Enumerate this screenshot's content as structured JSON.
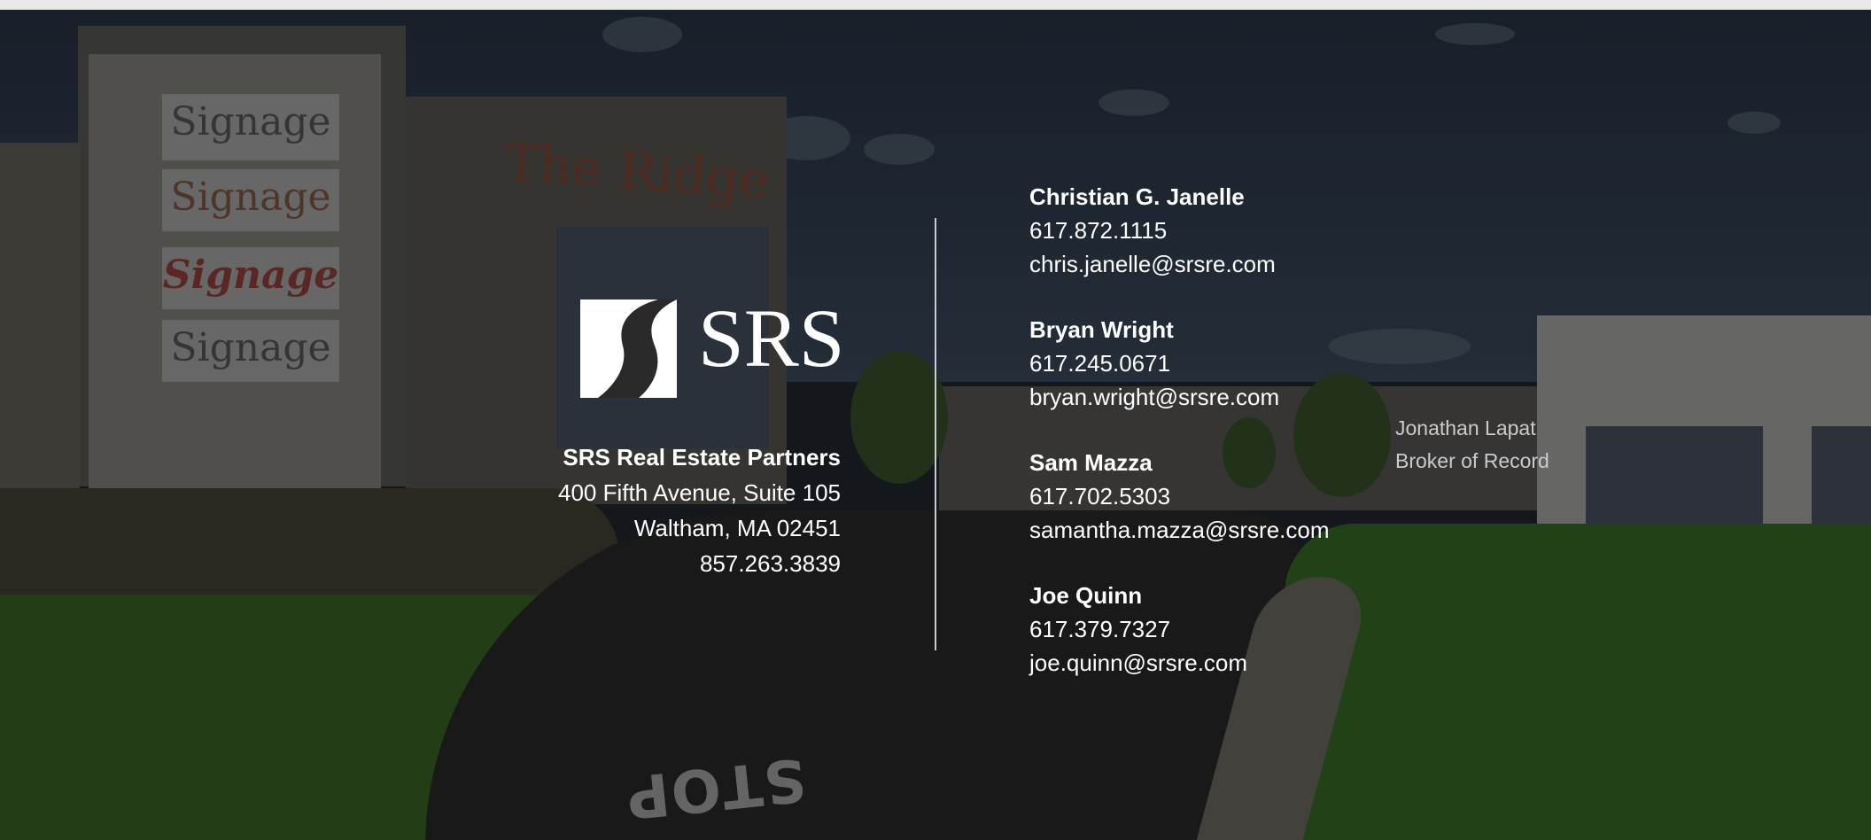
{
  "brand": {
    "logo_text": "SRS",
    "company_name": "SRS Real Estate Partners",
    "address_line1": "400 Fifth Avenue, Suite 105",
    "address_line2": "Waltham, MA 02451",
    "phone": "857.263.3839"
  },
  "background": {
    "building_title": "The Ridge",
    "signs": [
      "Signage",
      "Signage",
      "Signage",
      "Signage"
    ],
    "road_marking": "STOP"
  },
  "contacts": [
    {
      "name": "Christian G. Janelle",
      "phone": "617.872.1115",
      "email": "chris.janelle@srsre.com"
    },
    {
      "name": "Bryan Wright",
      "phone": "617.245.0671",
      "email": "bryan.wright@srsre.com"
    },
    {
      "name": "Sam Mazza",
      "phone": "617.702.5303",
      "email": "samantha.mazza@srsre.com"
    },
    {
      "name": "Joe Quinn",
      "phone": "617.379.7327",
      "email": "joe.quinn@srsre.com"
    }
  ],
  "broker": {
    "name": "Jonathan Lapat",
    "title": "Broker of Record"
  },
  "colors": {
    "text": "#ffffff",
    "muted_text": "#c9cbcf",
    "divider": "#c8cbcf"
  }
}
